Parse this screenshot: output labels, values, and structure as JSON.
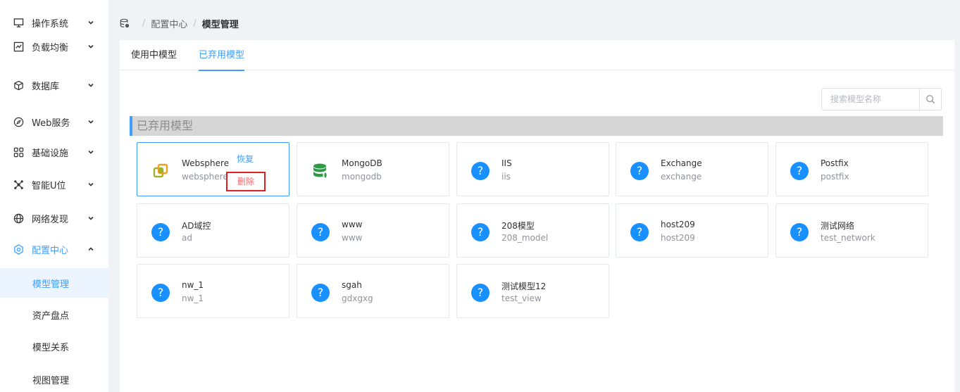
{
  "sidebar": {
    "items": [
      {
        "label": "操作系统",
        "icon": "monitor-icon"
      },
      {
        "label": "负载均衡",
        "icon": "line-chart-icon"
      },
      {
        "label": "数据库",
        "icon": "cube-icon"
      },
      {
        "label": "Web服务",
        "icon": "compass-icon"
      },
      {
        "label": "基础设施",
        "icon": "grid-icon"
      },
      {
        "label": "智能U位",
        "icon": "cluster-icon"
      },
      {
        "label": "网络发现",
        "icon": "globe-icon"
      },
      {
        "label": "配置中心",
        "icon": "settings-icon"
      }
    ],
    "sub_items": [
      {
        "label": "模型管理"
      },
      {
        "label": "资产盘点"
      },
      {
        "label": "模型关系"
      },
      {
        "label": "视图管理"
      }
    ]
  },
  "breadcrumb": {
    "home_icon": "database-icon",
    "parent": "配置中心",
    "separator": "/",
    "current": "模型管理"
  },
  "tabs": [
    {
      "label": "使用中模型"
    },
    {
      "label": "已弃用模型"
    }
  ],
  "search": {
    "placeholder": "搜索模型名称",
    "icon": "search-icon"
  },
  "section": {
    "title": "已弃用模型"
  },
  "card_actions": {
    "restore": "恢复",
    "delete": "删除"
  },
  "models": [
    {
      "name": "Websphere",
      "code": "websphere",
      "icon": "websphere-icon"
    },
    {
      "name": "MongoDB",
      "code": "mongodb",
      "icon": "mongodb-icon"
    },
    {
      "name": "IIS",
      "code": "iis",
      "icon": "question-icon"
    },
    {
      "name": "Exchange",
      "code": "exchange",
      "icon": "question-icon"
    },
    {
      "name": "Postfix",
      "code": "postfix",
      "icon": "question-icon"
    },
    {
      "name": "AD域控",
      "code": "ad",
      "icon": "question-icon"
    },
    {
      "name": "www",
      "code": "www",
      "icon": "question-icon"
    },
    {
      "name": "208模型",
      "code": "208_model",
      "icon": "question-icon"
    },
    {
      "name": "host209",
      "code": "host209",
      "icon": "question-icon"
    },
    {
      "name": "测试网络",
      "code": "test_network",
      "icon": "question-icon"
    },
    {
      "name": "nw_1",
      "code": "nw_1",
      "icon": "question-icon"
    },
    {
      "name": "sgah",
      "code": "gdxgxg",
      "icon": "question-icon"
    },
    {
      "name": "测试模型12",
      "code": "test_view",
      "icon": "question-icon"
    }
  ],
  "colors": {
    "accent": "#409eff",
    "question_icon": "#1890ff",
    "delete": "#f56c6c"
  }
}
